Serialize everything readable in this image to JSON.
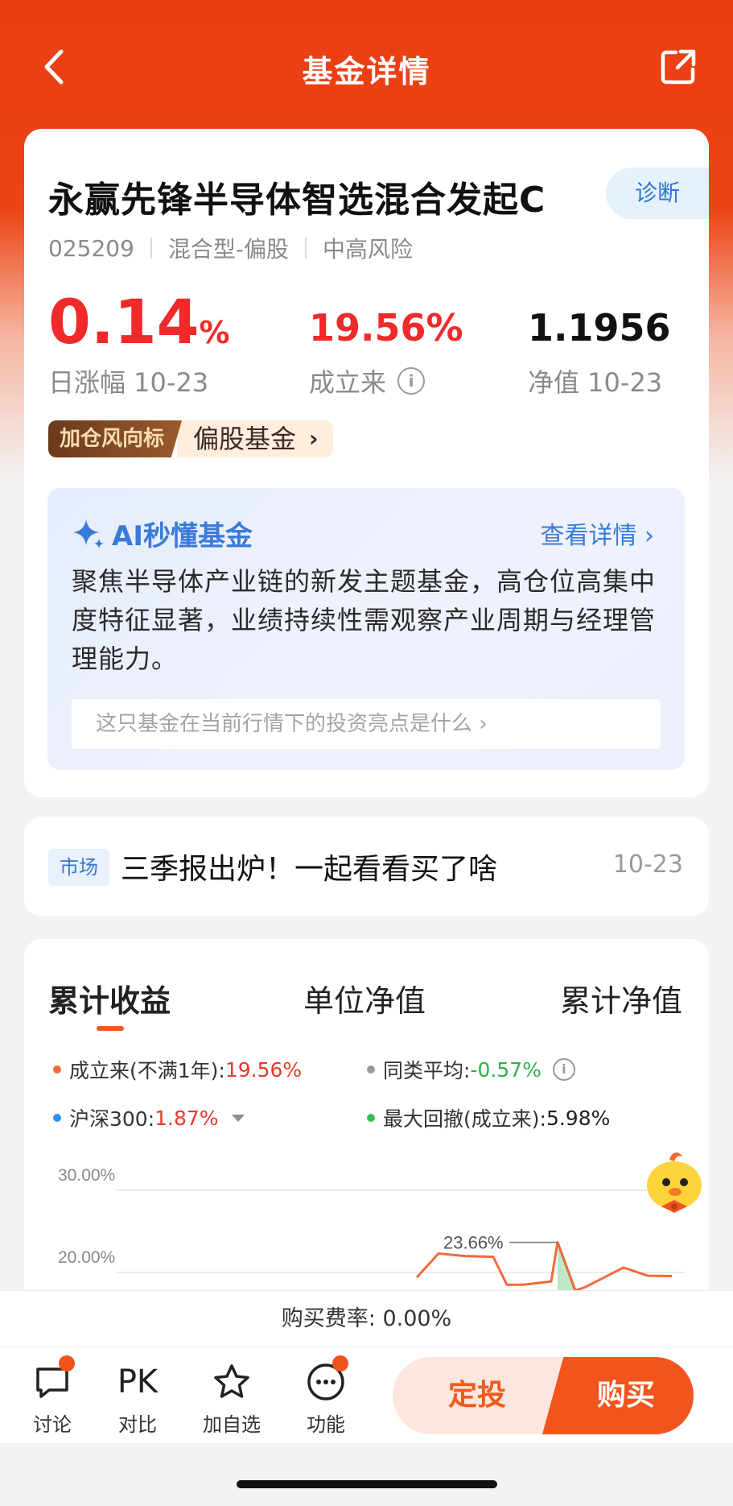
{
  "header": {
    "title": "基金详情"
  },
  "fund": {
    "name": "永赢先锋半导体智选混合发起C",
    "diagnose_label": "诊断",
    "code": "025209",
    "type": "混合型-偏股",
    "risk": "中高风险",
    "daily_change_value": "0.14",
    "daily_change_unit": "%",
    "daily_change_label": "日涨幅 10-23",
    "since_inception_value": "19.56%",
    "since_inception_label": "成立来",
    "nav_value": "1.1956",
    "nav_label": "净值 10-23",
    "tag_dark": "加仓风向标",
    "tag_light": "偏股基金"
  },
  "ai": {
    "title": "AI秒懂基金",
    "link": "查看详情",
    "text": "聚焦半导体产业链的新发主题基金，高仓位高集中度特征显著，业绩持续性需观察产业周期与经理管理能力。",
    "question": "这只基金在当前行情下的投资亮点是什么"
  },
  "news": {
    "tag": "市场",
    "title": "三季报出炉！一起看看买了啥",
    "date": "10-23"
  },
  "chart_tabs": [
    "累计收益",
    "单位净值",
    "累计净值"
  ],
  "legend": {
    "since_inception_label": "成立来(不满1年):",
    "since_inception_value": "19.56%",
    "peer_avg_label": "同类平均:",
    "peer_avg_value": "-0.57%",
    "hs300_label": "沪深300:",
    "hs300_value": "1.87%",
    "max_drawdown_label": "最大回撤(成立来):",
    "max_drawdown_value": "5.98%"
  },
  "colors": {
    "fund": "#f26a3d",
    "peer": "#9a9a9a",
    "hs300": "#2f8ff0",
    "drawdown": "#38c05a",
    "brand": "#f2541c"
  },
  "chart_data": {
    "type": "line",
    "yticks": [
      "30.00%",
      "20.00%"
    ],
    "peak_label": "23.66%",
    "series": [
      {
        "name": "成立来",
        "values": [
          19.4,
          22.3,
          22.0,
          21.9,
          18.5,
          18.5,
          18.9,
          23.66,
          17.8,
          18.2,
          20.6,
          19.6,
          19.56
        ]
      }
    ]
  },
  "fee": {
    "text": "购买费率: 0.00%"
  },
  "bottom": {
    "discuss": "讨论",
    "compare_icon": "PK",
    "compare": "对比",
    "watch": "加自选",
    "functions": "功能",
    "dingtou": "定投",
    "buy": "购买"
  }
}
